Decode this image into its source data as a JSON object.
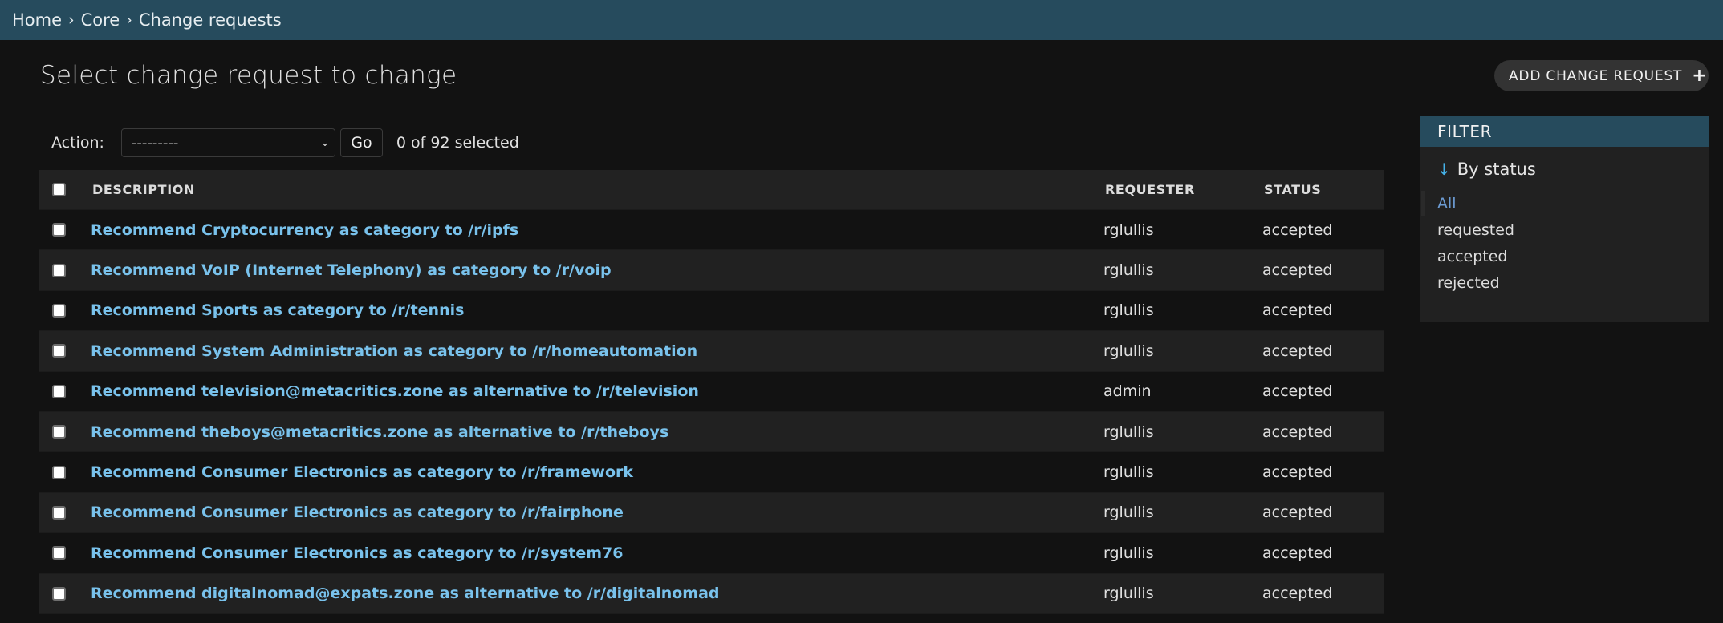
{
  "breadcrumb": {
    "items": [
      "Home",
      "Core",
      "Change requests"
    ],
    "separator": "›"
  },
  "page": {
    "title": "Select change request to change",
    "add_button_label": "ADD CHANGE REQUEST",
    "add_button_icon": "plus-icon"
  },
  "actions": {
    "label": "Action:",
    "select_value": "---------",
    "go_label": "Go",
    "selected_count": "0 of 92 selected"
  },
  "table": {
    "columns": [
      "DESCRIPTION",
      "REQUESTER",
      "STATUS"
    ],
    "rows": [
      {
        "description": "Recommend Cryptocurrency as category to /r/ipfs",
        "requester": "rglullis",
        "status": "accepted"
      },
      {
        "description": "Recommend VoIP (Internet Telephony) as category to /r/voip",
        "requester": "rglullis",
        "status": "accepted"
      },
      {
        "description": "Recommend Sports as category to /r/tennis",
        "requester": "rglullis",
        "status": "accepted"
      },
      {
        "description": "Recommend System Administration as category to /r/homeautomation",
        "requester": "rglullis",
        "status": "accepted"
      },
      {
        "description": "Recommend television@metacritics.zone as alternative to /r/television",
        "requester": "admin",
        "status": "accepted"
      },
      {
        "description": "Recommend theboys@metacritics.zone as alternative to /r/theboys",
        "requester": "rglullis",
        "status": "accepted"
      },
      {
        "description": "Recommend Consumer Electronics as category to /r/framework",
        "requester": "rglullis",
        "status": "accepted"
      },
      {
        "description": "Recommend Consumer Electronics as category to /r/fairphone",
        "requester": "rglullis",
        "status": "accepted"
      },
      {
        "description": "Recommend Consumer Electronics as category to /r/system76",
        "requester": "rglullis",
        "status": "accepted"
      },
      {
        "description": "Recommend digitalnomad@expats.zone as alternative to /r/digitalnomad",
        "requester": "rglullis",
        "status": "accepted"
      }
    ]
  },
  "filter": {
    "header": "FILTER",
    "section_title": "By status",
    "section_icon": "arrow-down-icon",
    "options": [
      {
        "label": "All",
        "selected": true
      },
      {
        "label": "requested",
        "selected": false
      },
      {
        "label": "accepted",
        "selected": false
      },
      {
        "label": "rejected",
        "selected": false
      }
    ]
  },
  "colors": {
    "header_bg": "#264b5d",
    "link": "#79c2ec",
    "selected_filter": "#6c9bd2",
    "page_bg": "#121212"
  }
}
